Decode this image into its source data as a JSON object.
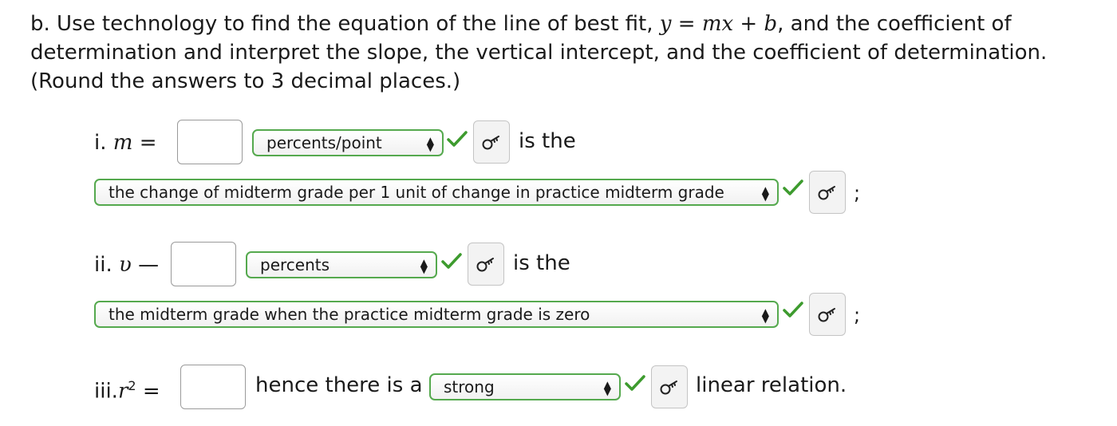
{
  "question": {
    "part_label": "b. Use technology to find the equation of the line of best fit,",
    "equation_y": "y",
    "equation_eq": " = ",
    "equation_rhs": "mx + b",
    "part_tail": ", and the coefficient of determination and interpret the slope, the vertical intercept, and the coefficient of determination. (Round the answers to 3 decimal places.)"
  },
  "row1": {
    "label": "i.",
    "var": "m",
    "eq": "=",
    "input_value": "",
    "unit_select": "percents/point",
    "tail": "is the",
    "interp_select": "the change of midterm grade per 1 unit of change in practice midterm grade",
    "end": ";"
  },
  "row2": {
    "label": "ii.",
    "var": "υ",
    "eq": "—",
    "input_value": "",
    "unit_select": "percents",
    "tail": "is the",
    "interp_select": "the midterm grade when the practice midterm grade is zero",
    "end": ";"
  },
  "row3": {
    "label": "iii.",
    "var": "r",
    "sup": "2",
    "eq": "=",
    "input_value": "",
    "lead": "hence there is a",
    "strength_select": "strong",
    "tail": "linear relation."
  },
  "icons": {
    "check": "checkmark-icon",
    "key": "key-icon",
    "arrows": "updown-arrows-icon"
  },
  "colors": {
    "correct_green": "#55a94e",
    "check_green": "#3d9b2e"
  }
}
